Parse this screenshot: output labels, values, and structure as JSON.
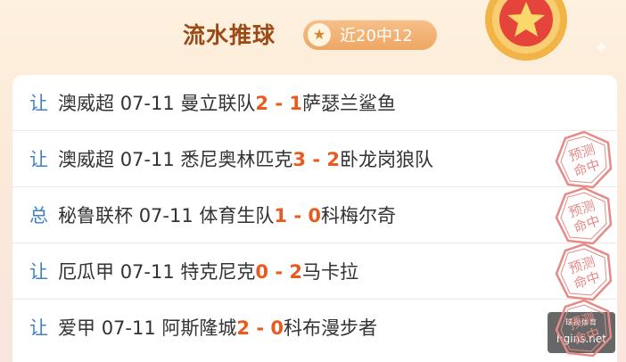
{
  "header": {
    "title": "流水推球",
    "record_icon": "star-icon",
    "record_text": "近20中12"
  },
  "stamp": {
    "line1": "预测",
    "line2": "命中",
    "color": "#e58a86"
  },
  "matches": [
    {
      "type": "让",
      "league": "澳威超",
      "date": "07-11",
      "home": "曼立联队",
      "home_score": "2",
      "separator": " - ",
      "away_score": "1",
      "away": "萨瑟兰鲨鱼",
      "hit": false
    },
    {
      "type": "让",
      "league": "澳威超",
      "date": "07-11",
      "home": "悉尼奥林匹克",
      "home_score": "3",
      "separator": " - ",
      "away_score": "2",
      "away": "卧龙岗狼队",
      "hit": true
    },
    {
      "type": "总",
      "league": "秘鲁联杯",
      "date": "07-11",
      "home": "体育生队",
      "home_score": "1",
      "separator": " - ",
      "away_score": "0",
      "away": "科梅尔奇",
      "hit": true
    },
    {
      "type": "让",
      "league": "厄瓜甲",
      "date": "07-11",
      "home": "特克尼克",
      "home_score": "0",
      "separator": " - ",
      "away_score": "2",
      "away": "马卡拉",
      "hit": true
    },
    {
      "type": "让",
      "league": "爱甲",
      "date": "07-11",
      "home": "阿斯隆城",
      "home_score": "2",
      "separator": " - ",
      "away_score": "0",
      "away": "科布漫步者",
      "hit": true
    }
  ],
  "watermark": {
    "top": "球探体育",
    "url": "hgins.net"
  }
}
